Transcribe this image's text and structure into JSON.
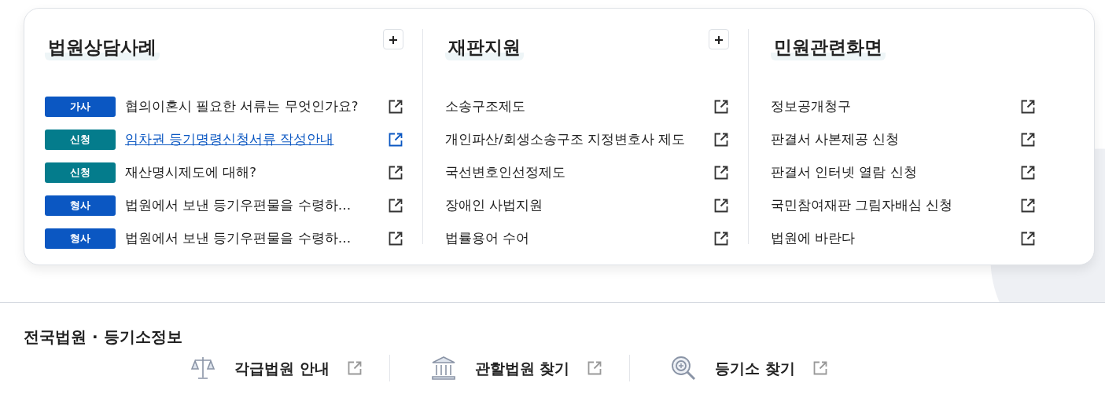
{
  "panels": [
    {
      "title": "법원상담사례",
      "has_add": true,
      "items": [
        {
          "tag": "가사",
          "color": "#0b57c2",
          "text": "협의이혼시 필요한 서류는 무엇인가요?",
          "selected": false
        },
        {
          "tag": "신청",
          "color": "#047c8c",
          "text": "임차권 등기명령신청서류 작성안내",
          "selected": true
        },
        {
          "tag": "신청",
          "color": "#047c8c",
          "text": "재산명시제도에 대해?",
          "selected": false
        },
        {
          "tag": "형사",
          "color": "#0b57c2",
          "text": "법원에서 보낸 등기우편물을 수령하…",
          "selected": false
        },
        {
          "tag": "형사",
          "color": "#0b57c2",
          "text": "법원에서 보낸 등기우편물을 수령하…",
          "selected": false
        }
      ]
    },
    {
      "title": "재판지원",
      "has_add": true,
      "items": [
        {
          "text": "소송구조제도",
          "selected": false
        },
        {
          "text": "개인파산/회생소송구조 지정변호사 제도",
          "selected": false
        },
        {
          "text": "국선변호인선정제도",
          "selected": false
        },
        {
          "text": "장애인 사법지원",
          "selected": false
        },
        {
          "text": "법률용어 수어",
          "selected": false
        }
      ]
    },
    {
      "title": "민원관련화면",
      "has_add": false,
      "items": [
        {
          "text": "정보공개청구",
          "selected": false
        },
        {
          "text": "판결서 사본제공 신청",
          "selected": false
        },
        {
          "text": "판결서 인터넷 열람 신청",
          "selected": false
        },
        {
          "text": "국민참여재판 그림자배심 신청",
          "selected": false
        },
        {
          "text": "법원에 바란다",
          "selected": false
        }
      ]
    }
  ],
  "court_info": {
    "title": "전국법원 · 등기소정보",
    "links": [
      {
        "kind": "scales",
        "label": "각급법원 안내"
      },
      {
        "kind": "building",
        "label": "관할법원 찾기"
      },
      {
        "kind": "search",
        "label": "등기소 찾기"
      }
    ]
  }
}
